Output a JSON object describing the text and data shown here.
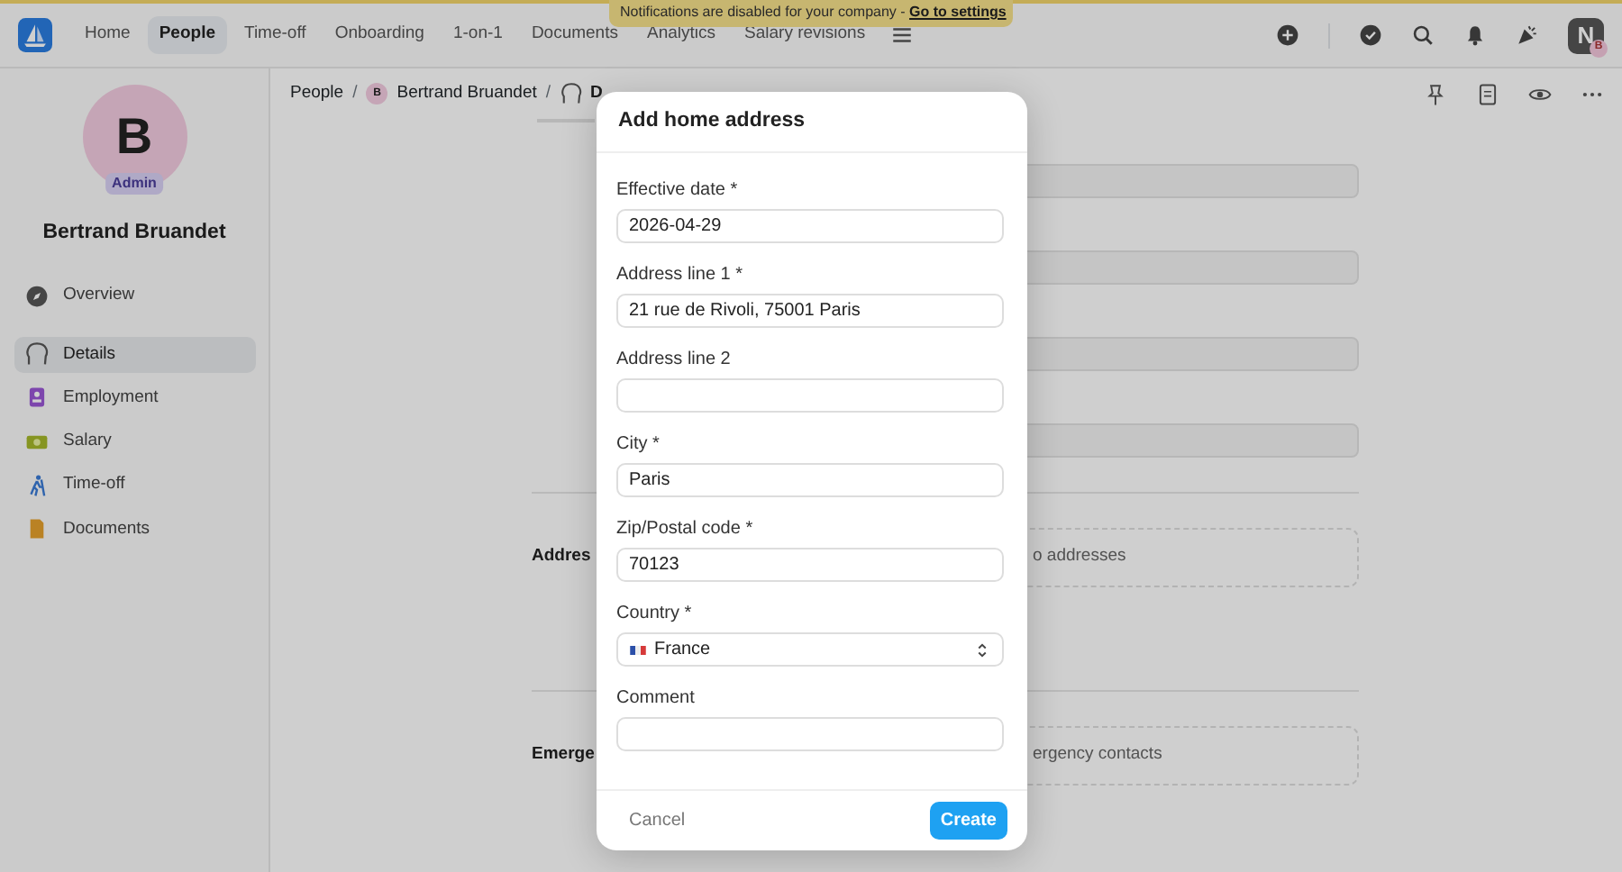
{
  "topbar": {
    "nav": [
      {
        "label": "Home",
        "selected": false
      },
      {
        "label": "People",
        "selected": true
      },
      {
        "label": "Time-off",
        "selected": false
      },
      {
        "label": "Onboarding",
        "selected": false
      },
      {
        "label": "1-on-1",
        "selected": false
      },
      {
        "label": "Documents",
        "selected": false
      },
      {
        "label": "Analytics",
        "selected": false
      },
      {
        "label": "Salary revisions",
        "selected": false
      }
    ],
    "banner": {
      "text": "Notifications are disabled for your company - ",
      "link": "Go to settings"
    },
    "user_avatar": {
      "initial": "N",
      "badge": "B"
    }
  },
  "sidebar": {
    "avatar": {
      "initial": "B",
      "role": "Admin"
    },
    "name": "Bertrand Bruandet",
    "items": [
      {
        "label": "Overview",
        "selected": false,
        "kind": "overview"
      },
      {
        "label": "Details",
        "selected": true,
        "kind": "details"
      },
      {
        "label": "Employment",
        "selected": false,
        "kind": "employment"
      },
      {
        "label": "Salary",
        "selected": false,
        "kind": "salary"
      },
      {
        "label": "Time-off",
        "selected": false,
        "kind": "timeoff"
      },
      {
        "label": "Documents",
        "selected": false,
        "kind": "documents"
      }
    ]
  },
  "breadcrumb": [
    {
      "kind": "link",
      "label": "People"
    },
    {
      "kind": "separator",
      "label": "/"
    },
    {
      "kind": "person",
      "initial": "B",
      "label": "Bertrand Bruandet"
    },
    {
      "kind": "separator",
      "label": "/"
    },
    {
      "kind": "page",
      "label": "D"
    }
  ],
  "sections": [
    {
      "label": "Addres",
      "empty_text": "o addresses"
    },
    {
      "label": "Emerge",
      "empty_text": "ergency contacts"
    }
  ],
  "modal": {
    "title": "Add home address",
    "fields": [
      {
        "label": "Effective date *",
        "value": "2026-04-29",
        "kind": "text"
      },
      {
        "label": "Address line 1 *",
        "value": "21 rue de Rivoli, 75001 Paris",
        "kind": "text"
      },
      {
        "label": "Address line 2",
        "kind": "text"
      },
      {
        "label": "City *",
        "value": "Paris",
        "kind": "text"
      },
      {
        "label": "Zip/Postal code *",
        "value": "70123",
        "kind": "text"
      },
      {
        "label": "Country *",
        "value": "France",
        "kind": "select"
      },
      {
        "label": "Comment",
        "kind": "text"
      }
    ],
    "cancel": "Cancel",
    "create": "Create"
  }
}
